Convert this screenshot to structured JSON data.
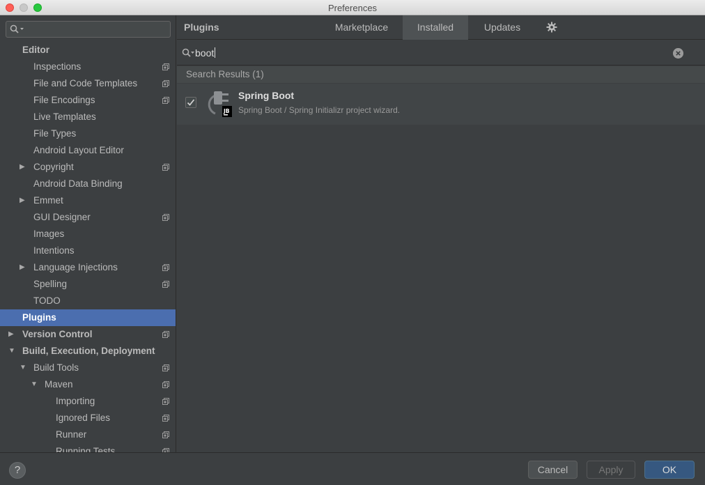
{
  "window": {
    "title": "Preferences"
  },
  "sidebar": {
    "search_placeholder": "",
    "items": [
      {
        "label": "Editor",
        "level": 0,
        "bold": true,
        "arrow": "",
        "project": false
      },
      {
        "label": "Inspections",
        "level": 1,
        "bold": false,
        "arrow": "",
        "project": true
      },
      {
        "label": "File and Code Templates",
        "level": 1,
        "bold": false,
        "arrow": "",
        "project": true
      },
      {
        "label": "File Encodings",
        "level": 1,
        "bold": false,
        "arrow": "",
        "project": true
      },
      {
        "label": "Live Templates",
        "level": 1,
        "bold": false,
        "arrow": "",
        "project": false
      },
      {
        "label": "File Types",
        "level": 1,
        "bold": false,
        "arrow": "",
        "project": false
      },
      {
        "label": "Android Layout Editor",
        "level": 1,
        "bold": false,
        "arrow": "",
        "project": false
      },
      {
        "label": "Copyright",
        "level": 1,
        "bold": false,
        "arrow": "collapsed",
        "project": true
      },
      {
        "label": "Android Data Binding",
        "level": 1,
        "bold": false,
        "arrow": "",
        "project": false
      },
      {
        "label": "Emmet",
        "level": 1,
        "bold": false,
        "arrow": "collapsed",
        "project": false
      },
      {
        "label": "GUI Designer",
        "level": 1,
        "bold": false,
        "arrow": "",
        "project": true
      },
      {
        "label": "Images",
        "level": 1,
        "bold": false,
        "arrow": "",
        "project": false
      },
      {
        "label": "Intentions",
        "level": 1,
        "bold": false,
        "arrow": "",
        "project": false
      },
      {
        "label": "Language Injections",
        "level": 1,
        "bold": false,
        "arrow": "collapsed",
        "project": true
      },
      {
        "label": "Spelling",
        "level": 1,
        "bold": false,
        "arrow": "",
        "project": true
      },
      {
        "label": "TODO",
        "level": 1,
        "bold": false,
        "arrow": "",
        "project": false
      },
      {
        "label": "Plugins",
        "level": 0,
        "bold": true,
        "arrow": "",
        "project": false,
        "selected": true
      },
      {
        "label": "Version Control",
        "level": 0,
        "bold": true,
        "arrow": "collapsed",
        "project": true
      },
      {
        "label": "Build, Execution, Deployment",
        "level": 0,
        "bold": true,
        "arrow": "expanded",
        "project": false
      },
      {
        "label": "Build Tools",
        "level": 1,
        "bold": false,
        "arrow": "expanded",
        "project": true
      },
      {
        "label": "Maven",
        "level": 2,
        "bold": false,
        "arrow": "expanded",
        "project": true
      },
      {
        "label": "Importing",
        "level": 3,
        "bold": false,
        "arrow": "",
        "project": true
      },
      {
        "label": "Ignored Files",
        "level": 3,
        "bold": false,
        "arrow": "",
        "project": true
      },
      {
        "label": "Runner",
        "level": 3,
        "bold": false,
        "arrow": "",
        "project": true
      },
      {
        "label": "Running Tests",
        "level": 3,
        "bold": false,
        "arrow": "",
        "project": true
      }
    ]
  },
  "main": {
    "title": "Plugins",
    "tabs": [
      {
        "label": "Marketplace",
        "active": false
      },
      {
        "label": "Installed",
        "active": true
      },
      {
        "label": "Updates",
        "active": false
      }
    ],
    "settings_icon": "gear-icon",
    "search": {
      "query": "boot"
    },
    "results_header": "Search Results (1)",
    "plugin": {
      "name": "Spring Boot",
      "description": "Spring Boot / Spring Initializr project wizard.",
      "enabled": true,
      "badge": "JB"
    }
  },
  "footer": {
    "help_label": "?",
    "cancel_label": "Cancel",
    "apply_label": "Apply",
    "ok_label": "OK"
  },
  "colors": {
    "selection": "#4b6eaf",
    "ok_button": "#365880",
    "background": "#3c3f41"
  }
}
